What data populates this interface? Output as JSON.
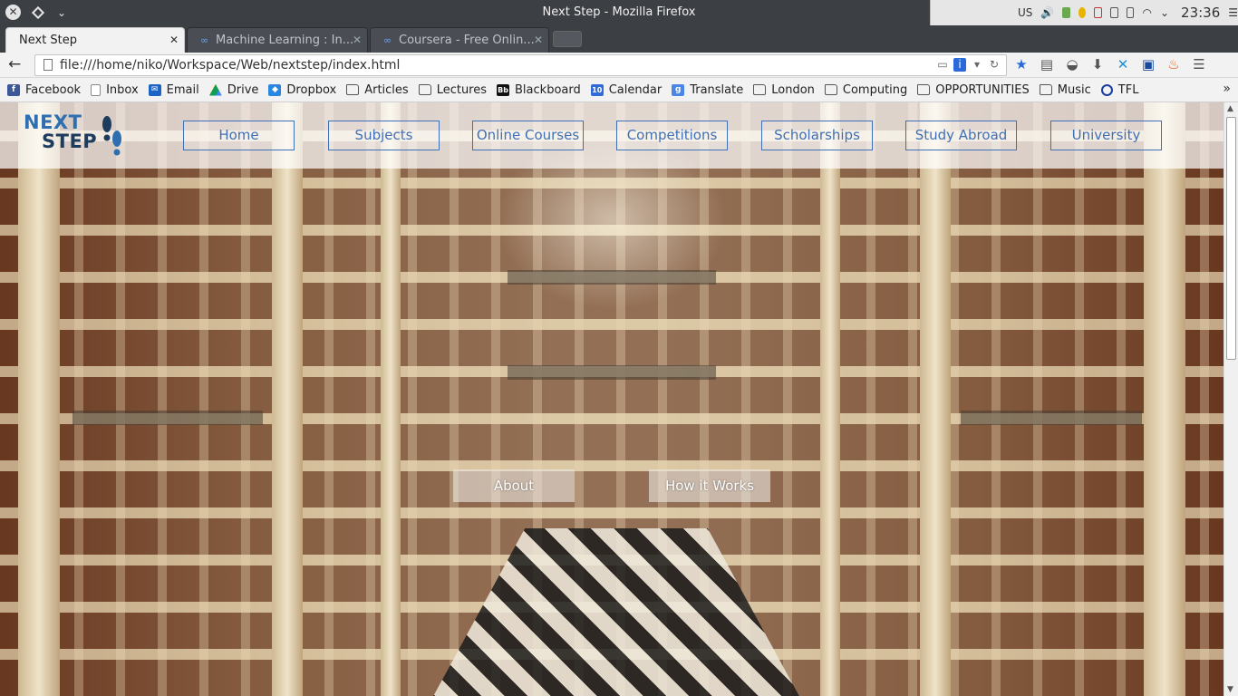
{
  "window": {
    "title": "Next Step - Mozilla Firefox",
    "tray": {
      "keyboard_layout": "US",
      "clock": "23:36"
    }
  },
  "tabs": [
    {
      "label": "Next Step",
      "active": true
    },
    {
      "label": "Machine Learning : In...",
      "active": false
    },
    {
      "label": "Coursera - Free Onlin...",
      "active": false
    }
  ],
  "navbar": {
    "url": "file:///home/niko/Workspace/Web/nextstep/index.html"
  },
  "bookmarks": [
    {
      "label": "Facebook",
      "icon": "facebook-icon",
      "color": "#3b5998"
    },
    {
      "label": "Inbox",
      "icon": "page-icon",
      "color": "#888888"
    },
    {
      "label": "Email",
      "icon": "mail-icon",
      "color": "#1c63c4"
    },
    {
      "label": "Drive",
      "icon": "drive-icon",
      "color": "#2aa14c"
    },
    {
      "label": "Dropbox",
      "icon": "dropbox-icon",
      "color": "#2a86e0"
    },
    {
      "label": "Articles",
      "icon": "folder-icon",
      "color": "#555555"
    },
    {
      "label": "Lectures",
      "icon": "folder-icon",
      "color": "#555555"
    },
    {
      "label": "Blackboard",
      "icon": "blackboard-icon",
      "color": "#111111"
    },
    {
      "label": "Calendar",
      "icon": "calendar-icon",
      "color": "#2f6ad8"
    },
    {
      "label": "Translate",
      "icon": "translate-icon",
      "color": "#4a86e8"
    },
    {
      "label": "London",
      "icon": "folder-icon",
      "color": "#555555"
    },
    {
      "label": "Computing",
      "icon": "folder-icon",
      "color": "#555555"
    },
    {
      "label": "OPPORTUNITIES",
      "icon": "folder-icon",
      "color": "#555555"
    },
    {
      "label": "Music",
      "icon": "folder-icon",
      "color": "#555555"
    },
    {
      "label": "TFL",
      "icon": "tfl-icon",
      "color": "#1a3e9e"
    }
  ],
  "page": {
    "logo_line1": "NEXT",
    "logo_line2": "STEP",
    "nav": [
      "Home",
      "Subjects",
      "Online Courses",
      "Competitions",
      "Scholarships",
      "Study Abroad",
      "University"
    ],
    "cta_about": "About",
    "cta_how": "How it Works",
    "accent_color": "#3f6fb6"
  }
}
